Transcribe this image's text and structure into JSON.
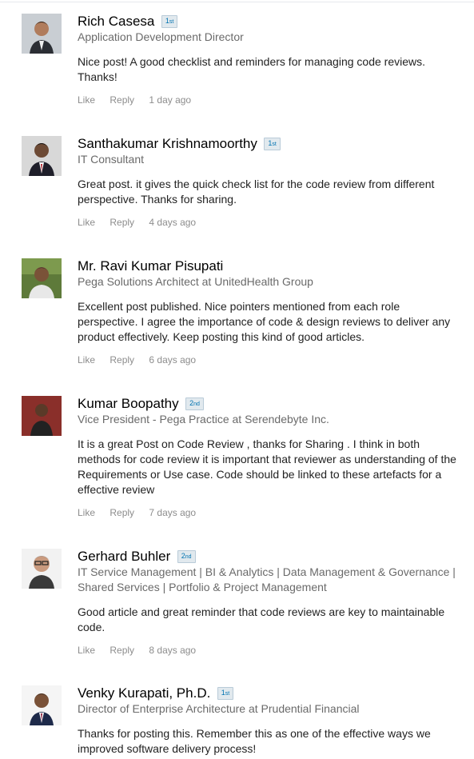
{
  "comments": [
    {
      "name": "Rich Casesa",
      "degree": "1",
      "degree_suffix": "st",
      "headline": "Application Development Director",
      "text": "Nice post! A good checklist and reminders for managing code reviews. Thanks!",
      "like": "Like",
      "reply": "Reply",
      "time": "1 day ago"
    },
    {
      "name": "Santhakumar Krishnamoorthy",
      "degree": "1",
      "degree_suffix": "st",
      "headline": "IT Consultant",
      "text": "Great post. it gives the quick check list for the code review from different perspective. Thanks for sharing.",
      "like": "Like",
      "reply": "Reply",
      "time": "4 days ago"
    },
    {
      "name": "Mr. Ravi Kumar Pisupati",
      "degree": "",
      "degree_suffix": "",
      "headline": "Pega Solutions Architect at UnitedHealth Group",
      "text": "Excellent post published. Nice pointers mentioned from each role perspective. I agree the importance of code & design reviews to deliver any product effectively. Keep posting this kind of good articles.",
      "like": "Like",
      "reply": "Reply",
      "time": "6 days ago"
    },
    {
      "name": "Kumar Boopathy",
      "degree": "2",
      "degree_suffix": "nd",
      "headline": "Vice President - Pega Practice at Serendebyte Inc.",
      "text": "It is a great Post on Code Review , thanks for Sharing . I think in both methods for code review it is important that reviewer as understanding of the Requirements or Use case. Code should be linked to these artefacts for a effective review",
      "like": "Like",
      "reply": "Reply",
      "time": "7 days ago"
    },
    {
      "name": "Gerhard Buhler",
      "degree": "2",
      "degree_suffix": "nd",
      "headline": "IT Service Management | BI & Analytics | Data Management & Governance | Shared Services | Portfolio & Project Management",
      "text": "Good article and great reminder that code reviews are key to maintainable code.",
      "like": "Like",
      "reply": "Reply",
      "time": "8 days ago"
    },
    {
      "name": "Venky Kurapati, Ph.D.",
      "degree": "1",
      "degree_suffix": "st",
      "headline": "Director of Enterprise Architecture at Prudential Financial",
      "text": "Thanks for posting this. Remember this as one of the effective ways we improved software delivery process!",
      "like": "",
      "reply": "",
      "time": ""
    }
  ]
}
